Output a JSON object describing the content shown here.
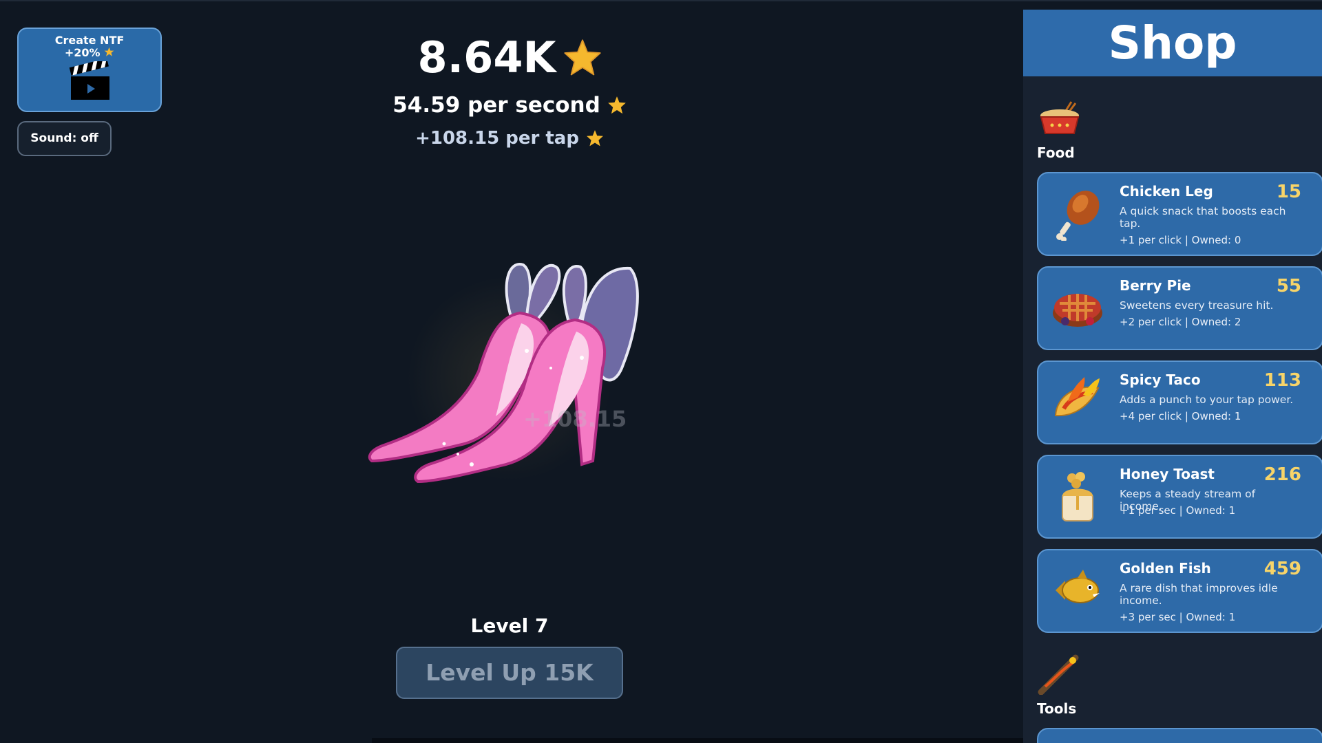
{
  "nft_button": {
    "title": "Create NTF",
    "bonus": "+20%"
  },
  "sound_button": {
    "label": "Sound: off"
  },
  "stats": {
    "total": "8.64K",
    "per_second": "54.59 per second",
    "per_tap": "+108.15 per tap"
  },
  "floating_text": "+108.15",
  "level": {
    "label": "Level 7",
    "button": "Level Up 15K"
  },
  "shop": {
    "title": "Shop",
    "categories": [
      {
        "label": "Food",
        "icon": "noodle-bowl-icon"
      },
      {
        "label": "Tools",
        "icon": "magic-wand-icon"
      }
    ],
    "items": [
      {
        "name": "Chicken Leg",
        "price": "15",
        "desc": "A quick snack that boosts each tap.",
        "stats": "+1 per click | Owned: 0",
        "icon": "chicken-leg-icon"
      },
      {
        "name": "Berry Pie",
        "price": "55",
        "desc": "Sweetens every treasure hit.",
        "stats": "+2 per click | Owned: 2",
        "icon": "berry-pie-icon"
      },
      {
        "name": "Spicy Taco",
        "price": "113",
        "desc": "Adds a punch to your tap power.",
        "stats": "+4 per click | Owned: 1",
        "icon": "taco-icon"
      },
      {
        "name": "Honey Toast",
        "price": "216",
        "desc": "Keeps a steady stream of income.",
        "stats": "+1 per sec | Owned: 1",
        "icon": "honey-toast-icon"
      },
      {
        "name": "Golden Fish",
        "price": "459",
        "desc": "A rare dish that improves idle income.",
        "stats": "+3 per sec | Owned: 1",
        "icon": "golden-fish-icon"
      }
    ]
  },
  "colors": {
    "background": "#0f1722",
    "shop_card": "#2e6aa8",
    "price": "#f7d469",
    "star": "#f5b82e"
  }
}
